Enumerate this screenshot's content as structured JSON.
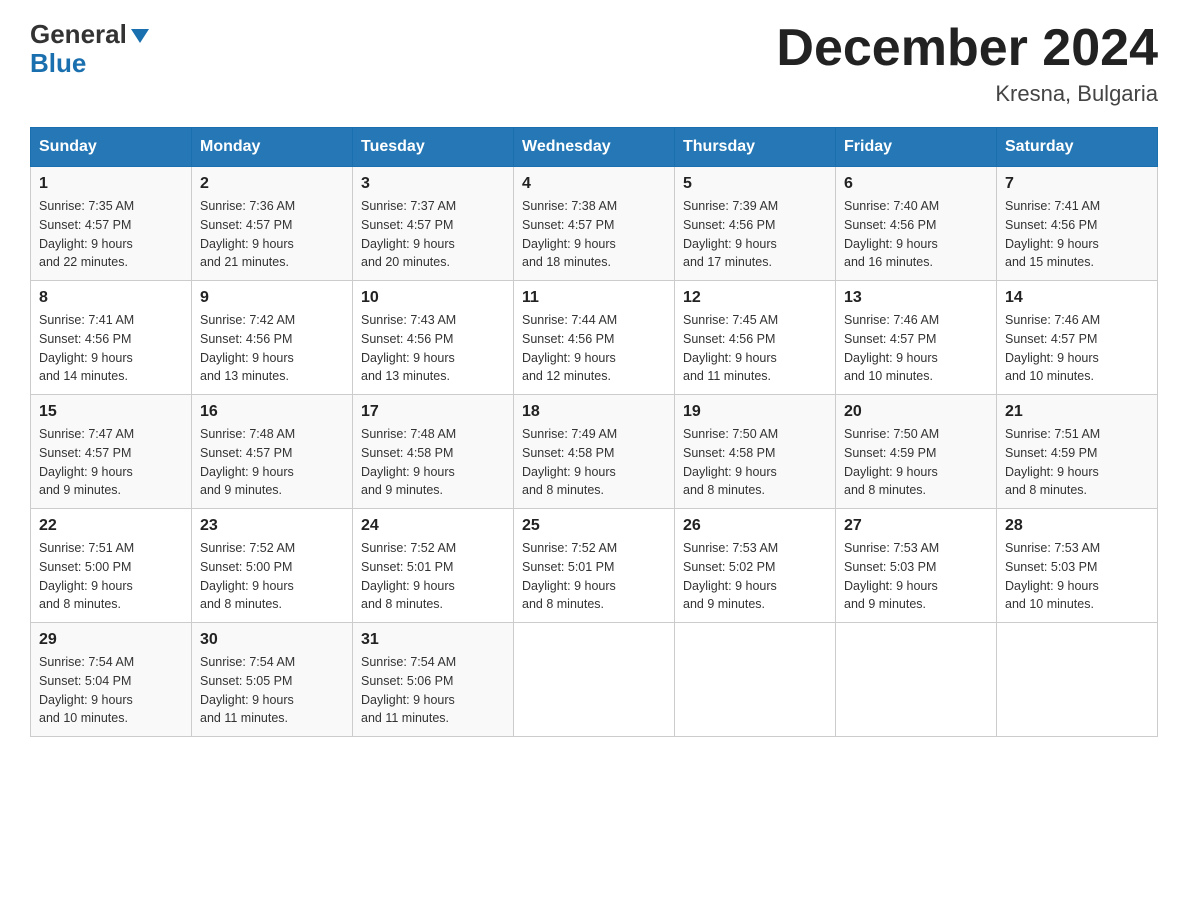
{
  "header": {
    "logo": {
      "general": "General",
      "blue": "Blue"
    },
    "title": "December 2024",
    "location": "Kresna, Bulgaria"
  },
  "weekdays": [
    "Sunday",
    "Monday",
    "Tuesday",
    "Wednesday",
    "Thursday",
    "Friday",
    "Saturday"
  ],
  "weeks": [
    [
      {
        "day": "1",
        "sunrise": "7:35 AM",
        "sunset": "4:57 PM",
        "daylight": "9 hours and 22 minutes."
      },
      {
        "day": "2",
        "sunrise": "7:36 AM",
        "sunset": "4:57 PM",
        "daylight": "9 hours and 21 minutes."
      },
      {
        "day": "3",
        "sunrise": "7:37 AM",
        "sunset": "4:57 PM",
        "daylight": "9 hours and 20 minutes."
      },
      {
        "day": "4",
        "sunrise": "7:38 AM",
        "sunset": "4:57 PM",
        "daylight": "9 hours and 18 minutes."
      },
      {
        "day": "5",
        "sunrise": "7:39 AM",
        "sunset": "4:56 PM",
        "daylight": "9 hours and 17 minutes."
      },
      {
        "day": "6",
        "sunrise": "7:40 AM",
        "sunset": "4:56 PM",
        "daylight": "9 hours and 16 minutes."
      },
      {
        "day": "7",
        "sunrise": "7:41 AM",
        "sunset": "4:56 PM",
        "daylight": "9 hours and 15 minutes."
      }
    ],
    [
      {
        "day": "8",
        "sunrise": "7:41 AM",
        "sunset": "4:56 PM",
        "daylight": "9 hours and 14 minutes."
      },
      {
        "day": "9",
        "sunrise": "7:42 AM",
        "sunset": "4:56 PM",
        "daylight": "9 hours and 13 minutes."
      },
      {
        "day": "10",
        "sunrise": "7:43 AM",
        "sunset": "4:56 PM",
        "daylight": "9 hours and 13 minutes."
      },
      {
        "day": "11",
        "sunrise": "7:44 AM",
        "sunset": "4:56 PM",
        "daylight": "9 hours and 12 minutes."
      },
      {
        "day": "12",
        "sunrise": "7:45 AM",
        "sunset": "4:56 PM",
        "daylight": "9 hours and 11 minutes."
      },
      {
        "day": "13",
        "sunrise": "7:46 AM",
        "sunset": "4:57 PM",
        "daylight": "9 hours and 10 minutes."
      },
      {
        "day": "14",
        "sunrise": "7:46 AM",
        "sunset": "4:57 PM",
        "daylight": "9 hours and 10 minutes."
      }
    ],
    [
      {
        "day": "15",
        "sunrise": "7:47 AM",
        "sunset": "4:57 PM",
        "daylight": "9 hours and 9 minutes."
      },
      {
        "day": "16",
        "sunrise": "7:48 AM",
        "sunset": "4:57 PM",
        "daylight": "9 hours and 9 minutes."
      },
      {
        "day": "17",
        "sunrise": "7:48 AM",
        "sunset": "4:58 PM",
        "daylight": "9 hours and 9 minutes."
      },
      {
        "day": "18",
        "sunrise": "7:49 AM",
        "sunset": "4:58 PM",
        "daylight": "9 hours and 8 minutes."
      },
      {
        "day": "19",
        "sunrise": "7:50 AM",
        "sunset": "4:58 PM",
        "daylight": "9 hours and 8 minutes."
      },
      {
        "day": "20",
        "sunrise": "7:50 AM",
        "sunset": "4:59 PM",
        "daylight": "9 hours and 8 minutes."
      },
      {
        "day": "21",
        "sunrise": "7:51 AM",
        "sunset": "4:59 PM",
        "daylight": "9 hours and 8 minutes."
      }
    ],
    [
      {
        "day": "22",
        "sunrise": "7:51 AM",
        "sunset": "5:00 PM",
        "daylight": "9 hours and 8 minutes."
      },
      {
        "day": "23",
        "sunrise": "7:52 AM",
        "sunset": "5:00 PM",
        "daylight": "9 hours and 8 minutes."
      },
      {
        "day": "24",
        "sunrise": "7:52 AM",
        "sunset": "5:01 PM",
        "daylight": "9 hours and 8 minutes."
      },
      {
        "day": "25",
        "sunrise": "7:52 AM",
        "sunset": "5:01 PM",
        "daylight": "9 hours and 8 minutes."
      },
      {
        "day": "26",
        "sunrise": "7:53 AM",
        "sunset": "5:02 PM",
        "daylight": "9 hours and 9 minutes."
      },
      {
        "day": "27",
        "sunrise": "7:53 AM",
        "sunset": "5:03 PM",
        "daylight": "9 hours and 9 minutes."
      },
      {
        "day": "28",
        "sunrise": "7:53 AM",
        "sunset": "5:03 PM",
        "daylight": "9 hours and 10 minutes."
      }
    ],
    [
      {
        "day": "29",
        "sunrise": "7:54 AM",
        "sunset": "5:04 PM",
        "daylight": "9 hours and 10 minutes."
      },
      {
        "day": "30",
        "sunrise": "7:54 AM",
        "sunset": "5:05 PM",
        "daylight": "9 hours and 11 minutes."
      },
      {
        "day": "31",
        "sunrise": "7:54 AM",
        "sunset": "5:06 PM",
        "daylight": "9 hours and 11 minutes."
      },
      null,
      null,
      null,
      null
    ]
  ],
  "labels": {
    "sunrise": "Sunrise:",
    "sunset": "Sunset:",
    "daylight": "Daylight:"
  }
}
